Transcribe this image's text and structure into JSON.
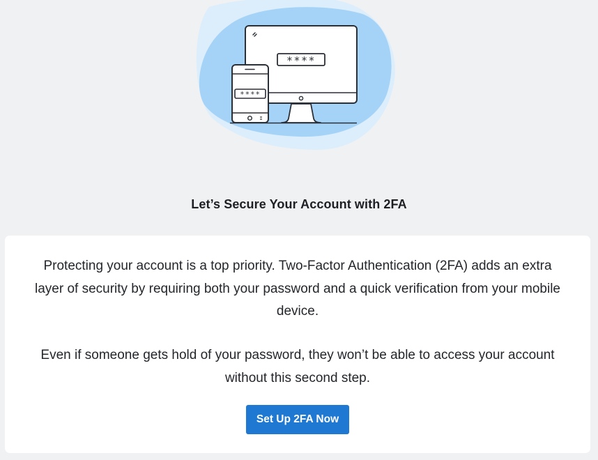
{
  "illustration": {
    "desktop_password_mask": "****",
    "mobile_password_mask": "****",
    "colors": {
      "blob_light": "#dcedfb",
      "blob_main": "#a5d3f8",
      "outline": "#2b2f36",
      "device_fill": "#ffffff"
    }
  },
  "headline": "Let’s Secure Your Account with 2FA",
  "card": {
    "paragraph_1": "Protecting your account is a top priority. Two-Factor Authentication (2FA) adds an extra layer of security by requiring both your password and a quick verification from your mobile device.",
    "paragraph_2": "Even if someone gets hold of your password, they won’t be able to access your account without this second step.",
    "cta_label": "Set Up 2FA Now"
  },
  "colors": {
    "page_background": "#f0f1f3",
    "card_background": "#ffffff",
    "primary_button": "#1f78d1",
    "text": "#23262b"
  }
}
